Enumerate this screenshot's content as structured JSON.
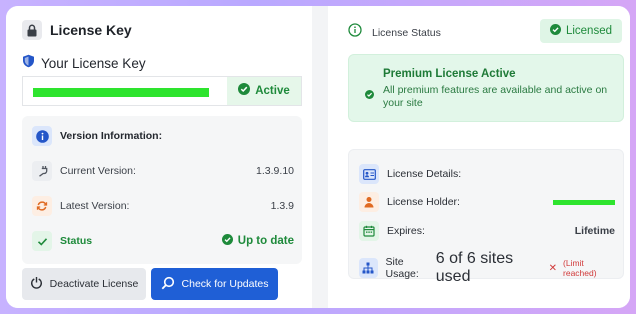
{
  "header": {
    "title": "License Key"
  },
  "license_key": {
    "heading": "Your License Key",
    "status_label": "Active"
  },
  "version_info": {
    "heading": "Version Information:",
    "current_label": "Current Version:",
    "current_value": "1.3.9.10",
    "latest_label": "Latest Version:",
    "latest_value": "1.3.9",
    "status_label": "Status",
    "status_value": "Up to date"
  },
  "buttons": {
    "deactivate": "Deactivate License",
    "check_updates": "Check for Updates"
  },
  "license_status": {
    "title": "License Status",
    "badge": "Licensed"
  },
  "premium": {
    "title": "Premium License Active",
    "description": "All premium features are available and active on your site"
  },
  "details": {
    "heading": "License Details:",
    "holder_label": "License Holder:",
    "expires_label": "Expires:",
    "expires_value": "Lifetime",
    "usage_label": "Site Usage:",
    "usage_value": "6 of 6 sites used",
    "usage_limit": "(Limit reached)"
  },
  "colors": {
    "accent_blue": "#1f5fd6",
    "success_green": "#1e8a3b",
    "danger_red": "#d13a3a",
    "redacted_green": "#2ee42e"
  },
  "icons": {
    "header": "lock-icon",
    "key": "shield-icon",
    "info": "info-icon",
    "current": "plug-icon",
    "latest": "refresh-icon",
    "status": "check-icon",
    "deactivate": "power-icon",
    "check": "search-icon",
    "license_status": "info-circle-icon",
    "details": "id-card-icon",
    "holder": "user-icon",
    "expires": "calendar-icon",
    "usage": "sitemap-icon"
  }
}
